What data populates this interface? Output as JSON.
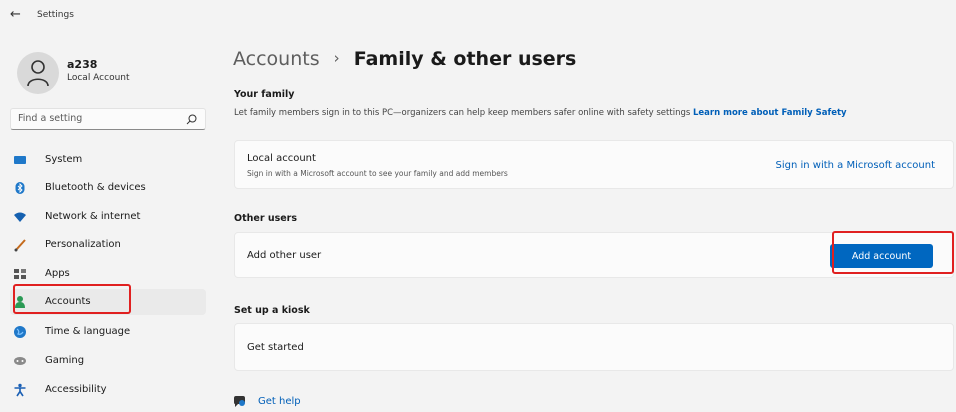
{
  "app": {
    "back_glyph": "←",
    "title": "Settings"
  },
  "profile": {
    "name": "a238",
    "account_type": "Local Account"
  },
  "search": {
    "placeholder": "Find a setting"
  },
  "sidebar": {
    "items": [
      {
        "label": "System",
        "icon": "system-icon",
        "color": "#0078d4"
      },
      {
        "label": "Bluetooth & devices",
        "icon": "bluetooth-icon",
        "color": "#0078d4"
      },
      {
        "label": "Network & internet",
        "icon": "network-icon",
        "color": "#0067c0"
      },
      {
        "label": "Personalization",
        "icon": "brush-icon",
        "color": "#c46a1c"
      },
      {
        "label": "Apps",
        "icon": "apps-icon",
        "color": "#555"
      },
      {
        "label": "Accounts",
        "icon": "accounts-icon",
        "color": "#2b9a55",
        "selected": true
      },
      {
        "label": "Time & language",
        "icon": "globe-icon",
        "color": "#0078d4"
      },
      {
        "label": "Gaming",
        "icon": "gaming-icon",
        "color": "#777"
      },
      {
        "label": "Accessibility",
        "icon": "accessibility-icon",
        "color": "#1a5fb4"
      }
    ]
  },
  "main": {
    "breadcrumb_parent": "Accounts",
    "breadcrumb_sep": "›",
    "breadcrumb_current": "Family & other users",
    "your_family": {
      "title": "Your family",
      "description": "Let family members sign in to this PC—organizers can help keep members safer online with safety settings",
      "learn_more": "Learn more about Family Safety"
    },
    "local_account": {
      "title": "Local account",
      "subtitle": "Sign in with a Microsoft account to see your family and add members",
      "link": "Sign in with a Microsoft account"
    },
    "other_users": {
      "title": "Other users",
      "row_label": "Add other user",
      "button": "Add account"
    },
    "kiosk": {
      "title": "Set up a kiosk",
      "row_label": "Get started"
    },
    "help": "Get help"
  },
  "colors": {
    "accent": "#0067c0",
    "link": "#005fb8",
    "annotation": "#e02020"
  }
}
